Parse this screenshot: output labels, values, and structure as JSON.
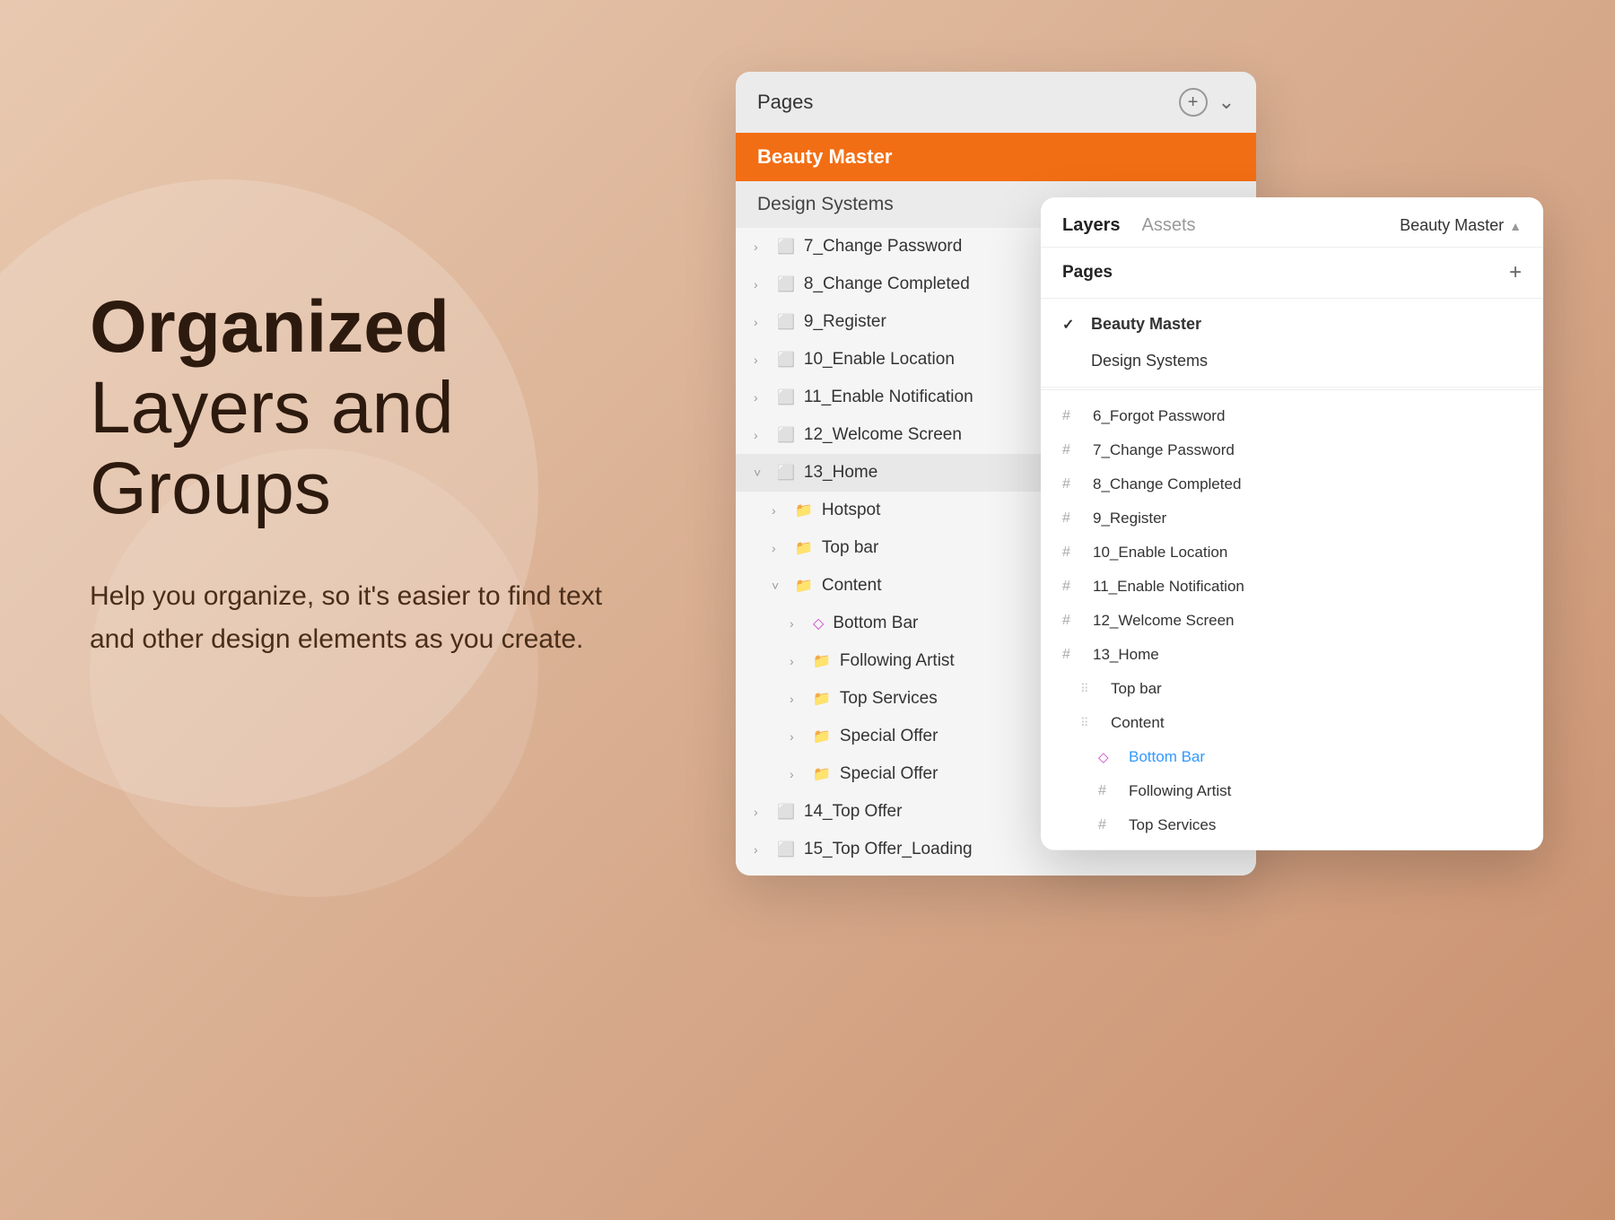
{
  "background": {
    "color": "#d4a98a"
  },
  "left": {
    "heading_bold": "Organized",
    "heading_normal": "Layers and Groups",
    "description": "Help you organize, so it's easier to find text\nand other design elements as you create."
  },
  "pages_panel": {
    "title": "Pages",
    "icon_plus": "+",
    "icon_chevron": "⌄",
    "active_page": "Beauty Master",
    "inactive_page": "Design Systems",
    "layers": [
      {
        "indent": 0,
        "icon": "frame",
        "chevron": "›",
        "label": "7_Change Password"
      },
      {
        "indent": 0,
        "icon": "frame",
        "chevron": "›",
        "label": "8_Change Completed"
      },
      {
        "indent": 0,
        "icon": "frame",
        "chevron": "›",
        "label": "9_Register"
      },
      {
        "indent": 0,
        "icon": "frame",
        "chevron": "›",
        "label": "10_Enable Location"
      },
      {
        "indent": 0,
        "icon": "frame",
        "chevron": "›",
        "label": "11_Enable Notification"
      },
      {
        "indent": 0,
        "icon": "frame",
        "chevron": "›",
        "label": "12_Welcome Screen"
      },
      {
        "indent": 0,
        "icon": "frame",
        "chevron": "˅",
        "label": "13_Home",
        "active": true
      },
      {
        "indent": 1,
        "icon": "folder",
        "chevron": "›",
        "label": "Hotspot"
      },
      {
        "indent": 1,
        "icon": "folder",
        "chevron": "›",
        "label": "Top bar"
      },
      {
        "indent": 1,
        "icon": "folder",
        "chevron": "˅",
        "label": "Content"
      },
      {
        "indent": 2,
        "icon": "diamond",
        "chevron": "›",
        "label": "Bottom Bar"
      },
      {
        "indent": 2,
        "icon": "folder",
        "chevron": "›",
        "label": "Following Artist"
      },
      {
        "indent": 2,
        "icon": "folder",
        "chevron": "›",
        "label": "Top Services"
      },
      {
        "indent": 2,
        "icon": "folder",
        "chevron": "›",
        "label": "Special Offer"
      },
      {
        "indent": 2,
        "icon": "folder",
        "chevron": "›",
        "label": "Special Offer"
      },
      {
        "indent": 0,
        "icon": "frame",
        "chevron": "›",
        "label": "14_Top Offer"
      },
      {
        "indent": 0,
        "icon": "frame",
        "chevron": "›",
        "label": "15_Top Offer_Loading"
      }
    ]
  },
  "layers_panel": {
    "tabs": {
      "layers": "Layers",
      "assets": "Assets"
    },
    "page_title": "Beauty Master",
    "pages_section": {
      "title": "Pages",
      "add_icon": "+",
      "items": [
        {
          "label": "Beauty Master",
          "active": true
        },
        {
          "label": "Design Systems",
          "active": false
        }
      ]
    },
    "layers_items": [
      {
        "type": "hash",
        "label": "6_Forgot Password"
      },
      {
        "type": "hash",
        "label": "7_Change Password"
      },
      {
        "type": "hash",
        "label": "8_Change Completed"
      },
      {
        "type": "hash",
        "label": "9_Register"
      },
      {
        "type": "hash",
        "label": "10_Enable Location"
      },
      {
        "type": "hash",
        "label": "11_Enable Notification"
      },
      {
        "type": "hash",
        "label": "12_Welcome Screen"
      },
      {
        "type": "hash",
        "label": "13_Home"
      },
      {
        "type": "grid",
        "indent": 1,
        "label": "Top bar"
      },
      {
        "type": "grid",
        "indent": 1,
        "label": "Content"
      },
      {
        "type": "diamond",
        "indent": 2,
        "label": "Bottom Bar",
        "special": true
      },
      {
        "type": "hash",
        "indent": 2,
        "label": "Following Artist"
      },
      {
        "type": "hash",
        "indent": 2,
        "label": "Top Services"
      }
    ]
  }
}
